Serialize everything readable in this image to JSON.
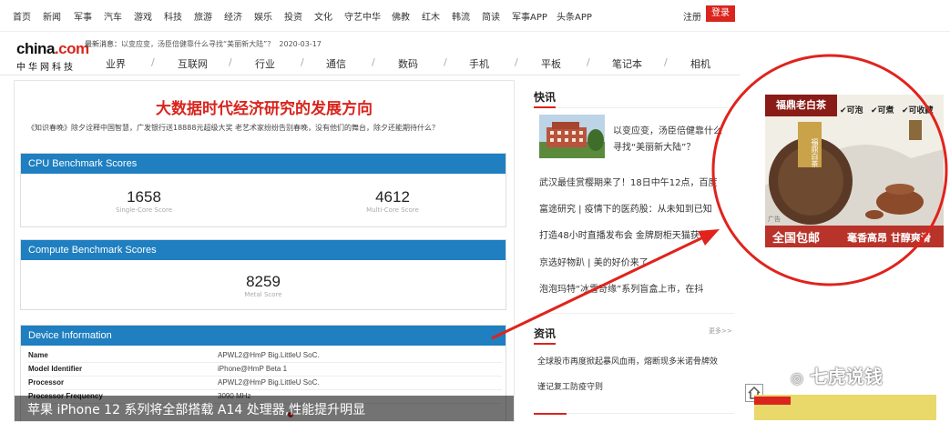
{
  "top_nav": [
    "首页",
    "新闻",
    "军事",
    "汽车",
    "游戏",
    "科技",
    "旅游",
    "经济",
    "娱乐",
    "投资",
    "文化",
    "守艺中华",
    "佛教",
    "红木",
    "韩流",
    "简读",
    "军事APP",
    "头条APP"
  ],
  "account": {
    "signup": "注册",
    "login": "登录"
  },
  "logo": {
    "en_main": "china",
    "en_dot": ".com",
    "cn": "中华网科技"
  },
  "latest_news": {
    "label": "最新消息：",
    "text": "以变应变，汤臣倍健靠什么寻找“美丽新大陆”？",
    "date": "2020-03-17"
  },
  "category_nav": [
    "业界",
    "互联网",
    "行业",
    "通信",
    "数码",
    "手机",
    "平板",
    "笔记本",
    "相机"
  ],
  "article": {
    "title": "大数据时代经济研究的发展方向",
    "subtitle": "《知识春晚》除夕诠释中国智慧，广发银行送18888元超级大奖    老艺术家纷纷告别春晚，没有他们的舞台，除夕还能期待什么？",
    "cpu_panel": {
      "header": "CPU Benchmark Scores",
      "single_value": "1658",
      "single_label": "Single-Core Score",
      "multi_value": "4612",
      "multi_label": "Multi-Core Score"
    },
    "compute_panel": {
      "header": "Compute Benchmark Scores",
      "value": "8259",
      "label": "Metal Score"
    },
    "device_panel": {
      "header": "Device Information",
      "rows": [
        {
          "k": "Name",
          "v": "APWL2@HmP Big.LittleU SoC."
        },
        {
          "k": "Model Identifier",
          "v": "iPhone@HmP Beta 1"
        },
        {
          "k": "Processor",
          "v": "APWL2@HmP Big.LittleU SoC."
        },
        {
          "k": "Processor Frequency",
          "v": "3090 MHz"
        }
      ]
    },
    "caption": "苹果 iPhone 12 系列将全部搭载 A14 处理器,性能提升明显"
  },
  "flash": {
    "title": "快讯",
    "thumb_text": "以变应变，汤臣倍健靠什么寻找“美丽新大陆”？",
    "items": [
      "武汉最佳赏樱期来了！18日中午12点，百度",
      "富途研究 | 疫情下的医药股：从未知到已知",
      "打造48小时直播发布会 金牌厨柜天猫获得",
      "京选好物趴 | 美的好价来了",
      "泡泡玛特“冰雪奇缘”系列盲盒上市，在抖"
    ]
  },
  "info": {
    "title": "资讯",
    "more": "更多>>",
    "items": [
      "全球股市再度掀起暴风血雨，熔断现多米诺骨牌效",
      "谨记复工防疫守则"
    ]
  },
  "ad": {
    "brand": "福鼎老白茶",
    "checks": [
      "可泡",
      "可煮",
      "可收藏"
    ],
    "free_shipping": "全国包邮",
    "slogan": "毫香高昂 甘醇爽滑",
    "tag": "广告",
    "cake_text": "福鼎白茶"
  },
  "watermark": "七虎说钱",
  "colors": {
    "accent": "#d9251d",
    "panel_header": "#1f7fc0",
    "circle": "#e0231c"
  }
}
